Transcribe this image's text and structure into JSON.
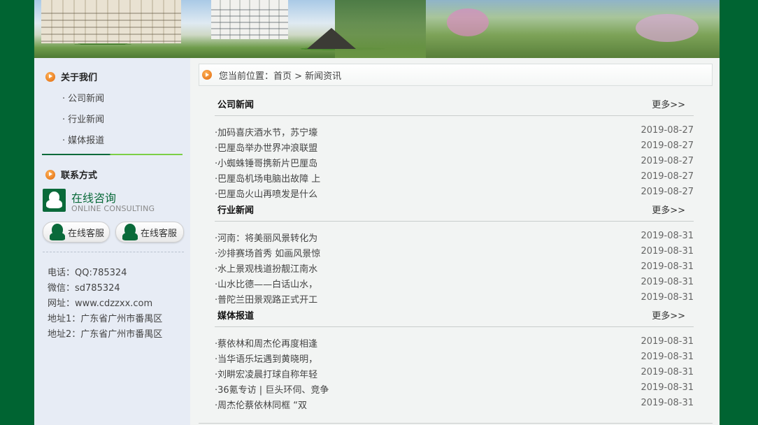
{
  "sidebar": {
    "about": {
      "title": "关于我们",
      "icon": "orange-arrow-icon",
      "items": [
        {
          "label": "公司新闻"
        },
        {
          "label": "行业新闻"
        },
        {
          "label": "媒体报道"
        }
      ],
      "bullet": "·"
    },
    "contact": {
      "title": "联系方式",
      "consult_title": "在线咨询",
      "consult_subtitle": "ONLINE CONSULTING",
      "qq_buttons": [
        {
          "label": "在线客服"
        },
        {
          "label": "在线客服"
        }
      ],
      "info": [
        {
          "text": "电话：QQ:785324"
        },
        {
          "text": "微信：sd785324"
        },
        {
          "text": "网址：www.cdzzxx.com"
        },
        {
          "text": "地址1：广东省广州市番禺区"
        },
        {
          "text": "地址2：广东省广州市番禺区"
        }
      ]
    }
  },
  "breadcrumb": {
    "text": "您当前位置：首页 > 新闻资讯"
  },
  "sections": [
    {
      "title": "公司新闻",
      "more": "更多>>",
      "items": [
        {
          "title": "·加码喜庆酒水节，苏宁壕",
          "date": "2019-08-27"
        },
        {
          "title": "·巴厘岛举办世界冲浪联盟",
          "date": "2019-08-27"
        },
        {
          "title": "·小蜘蛛锤哥携新片巴厘岛",
          "date": "2019-08-27"
        },
        {
          "title": "·巴厘岛机场电脑出故障 上",
          "date": "2019-08-27"
        },
        {
          "title": "·巴厘岛火山再喷发是什么",
          "date": "2019-08-27"
        }
      ]
    },
    {
      "title": "行业新闻",
      "more": "更多>>",
      "items": [
        {
          "title": "·河南：将美丽风景转化为",
          "date": "2019-08-31"
        },
        {
          "title": "·沙排赛场首秀 如画风景惊",
          "date": "2019-08-31"
        },
        {
          "title": "·水上景观栈道扮靓江南水",
          "date": "2019-08-31"
        },
        {
          "title": "·山水比德——白话山水，",
          "date": "2019-08-31"
        },
        {
          "title": "·普陀兰田景观路正式开工",
          "date": "2019-08-31"
        }
      ]
    },
    {
      "title": "媒体报道",
      "more": "更多>>",
      "items": [
        {
          "title": "·蔡依林和周杰伦再度相逢",
          "date": "2019-08-31"
        },
        {
          "title": "·当华语乐坛遇到黄晓明，",
          "date": "2019-08-31"
        },
        {
          "title": "·刘畊宏凌晨打球自称年轻",
          "date": "2019-08-31"
        },
        {
          "title": "·36氪专访 | 巨头环伺、竞争",
          "date": "2019-08-31"
        },
        {
          "title": "·周杰伦蔡依林同框 “双",
          "date": "2019-08-31"
        }
      ]
    }
  ],
  "colors": {
    "outer_background": "#006432",
    "brand_green": "#0a6a3a",
    "accent_light_green": "#7ccf46",
    "sidebar_background": "#e7ecf5",
    "arrow_orange": "#e0680a"
  }
}
